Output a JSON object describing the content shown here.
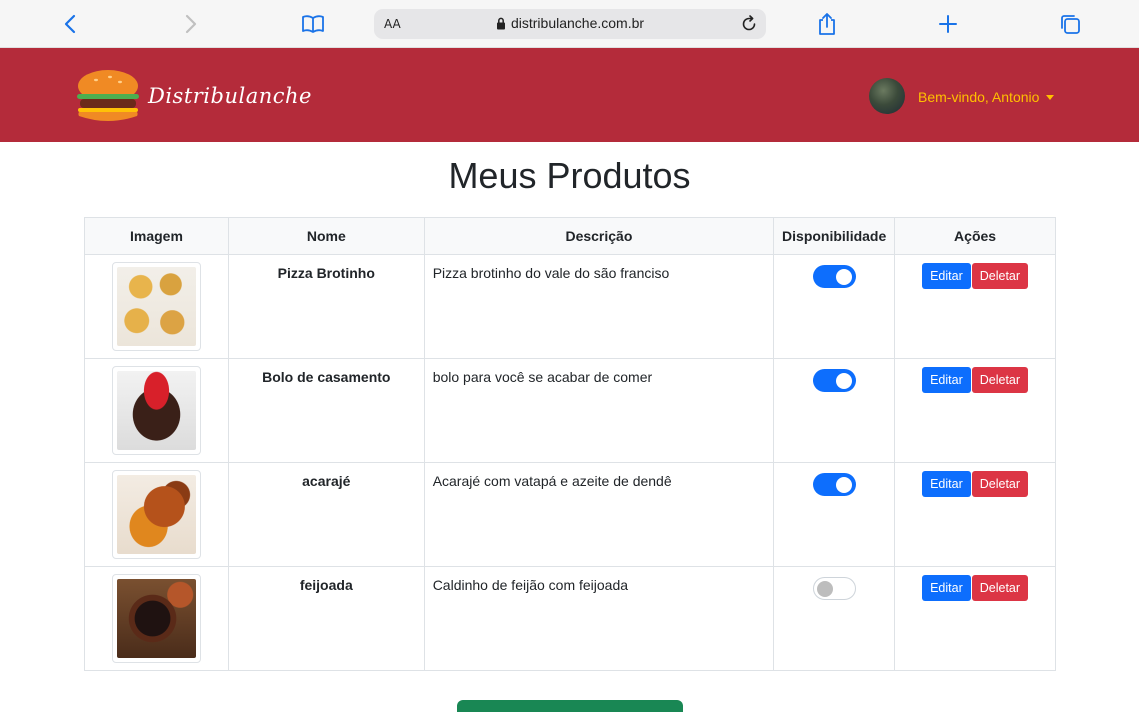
{
  "browser": {
    "url_prefix": "AA",
    "url": "distribulanche.com.br"
  },
  "navbar": {
    "brand": "Distribulanche",
    "welcome": "Bem-vindo, Antonio"
  },
  "page": {
    "title": "Meus Produtos"
  },
  "table": {
    "headers": [
      "Imagem",
      "Nome",
      "Descrição",
      "Disponibilidade",
      "Ações"
    ],
    "rows": [
      {
        "name": "Pizza Brotinho",
        "description": "Pizza brotinho do vale do são franciso",
        "available": true,
        "image": "pizza",
        "edit_label": "Editar",
        "delete_label": "Deletar"
      },
      {
        "name": "Bolo de casamento",
        "description": "bolo para você se acabar de comer",
        "available": true,
        "image": "cake",
        "edit_label": "Editar",
        "delete_label": "Deletar"
      },
      {
        "name": "acarajé",
        "description": "Acarajé com vatapá e azeite de dendê",
        "available": true,
        "image": "acaraje",
        "edit_label": "Editar",
        "delete_label": "Deletar"
      },
      {
        "name": "feijoada",
        "description": "Caldinho de feijão com feijoada",
        "available": false,
        "image": "feijoada",
        "edit_label": "Editar",
        "delete_label": "Deletar"
      }
    ]
  },
  "colors": {
    "navbar": "#b42b3a",
    "welcome": "#ffc000",
    "edit": "#0d6efd",
    "delete": "#dc3545",
    "add_button": "#198754"
  },
  "icons": {
    "back": "chevron-left-icon",
    "forward": "chevron-right-icon",
    "bookmarks": "book-icon",
    "lock": "lock-icon",
    "reload": "reload-icon",
    "share": "share-icon",
    "new_tab": "plus-icon",
    "tabs": "tabs-icon"
  }
}
